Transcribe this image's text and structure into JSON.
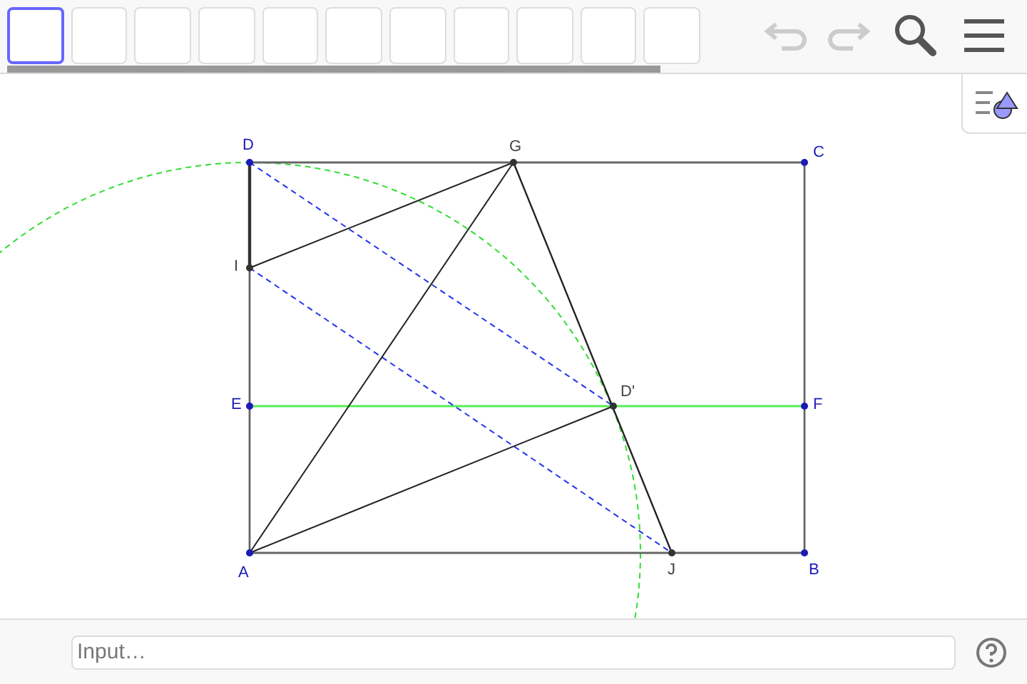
{
  "toolbar": {
    "tools": [
      {
        "selected": true
      },
      {
        "selected": false
      },
      {
        "selected": false
      },
      {
        "selected": false
      },
      {
        "selected": false
      },
      {
        "selected": false
      },
      {
        "selected": false
      },
      {
        "selected": false
      },
      {
        "selected": false
      },
      {
        "selected": false
      },
      {
        "selected": false
      }
    ],
    "undo": {
      "disabled": true
    },
    "redo": {
      "disabled": true
    }
  },
  "graphics": {
    "points": [
      {
        "label": "D",
        "color": "#1a1ab8"
      },
      {
        "label": "G",
        "color": "#333333"
      },
      {
        "label": "C",
        "color": "#1a1ab8"
      },
      {
        "label": "I",
        "color": "#333333"
      },
      {
        "label": "D'",
        "color": "#333333"
      },
      {
        "label": "E",
        "color": "#1a1ab8"
      },
      {
        "label": "F",
        "color": "#1a1ab8"
      },
      {
        "label": "A",
        "color": "#1a1ab8"
      },
      {
        "label": "J",
        "color": "#333333"
      },
      {
        "label": "B",
        "color": "#1a1ab8"
      }
    ]
  },
  "input_bar": {
    "placeholder": "Input…"
  }
}
